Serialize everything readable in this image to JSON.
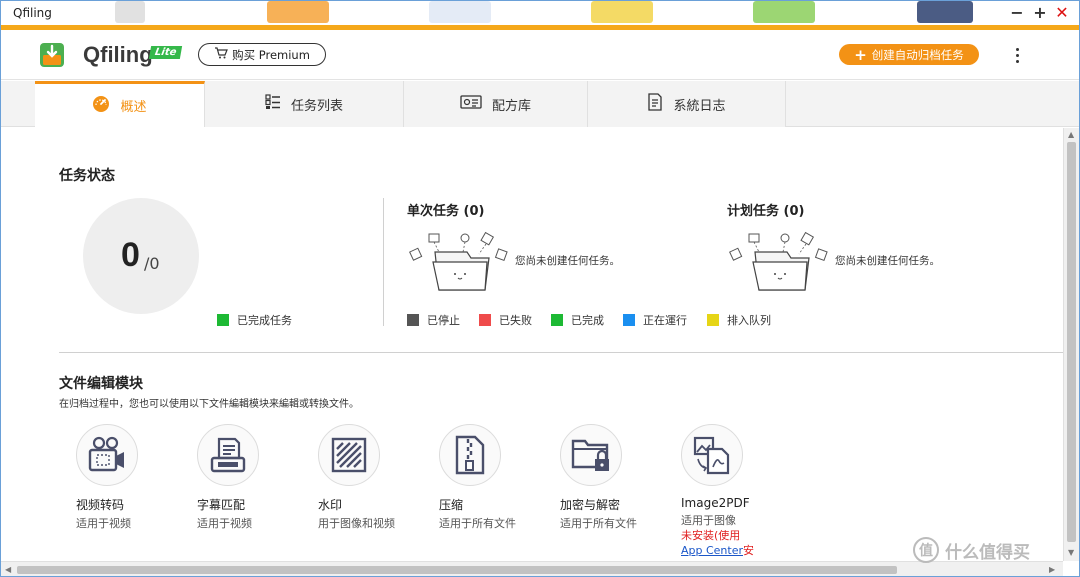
{
  "window": {
    "title": "Qfiling",
    "controls": {
      "minimize": "−",
      "maximize": "+",
      "close": "✕"
    }
  },
  "header": {
    "brand": "Qfiling",
    "badge": "Lite",
    "premium_label": "购买 Premium",
    "create_label": "创建自动归档任务",
    "create_icon": "plus-icon",
    "more_icon": "more-vertical-icon"
  },
  "tabs": [
    {
      "label": "概述",
      "icon": "dashboard-icon",
      "active": true
    },
    {
      "label": "任务列表",
      "icon": "task-list-icon",
      "active": false
    },
    {
      "label": "配方库",
      "icon": "recipe-icon",
      "active": false
    },
    {
      "label": "系統日志",
      "icon": "log-icon",
      "active": false
    }
  ],
  "task_status": {
    "title": "任务状态",
    "completed": "0",
    "total": "/0",
    "legend_completed": "已完成任务",
    "one_time": {
      "title": "单次任务 (0)",
      "empty": "您尚未创建任何任务。"
    },
    "scheduled": {
      "title": "计划任务 (0)",
      "empty": "您尚未创建任何任务。"
    },
    "status_legend": [
      {
        "label": "已停止",
        "color": "#555555"
      },
      {
        "label": "已失败",
        "color": "#ef4b4b"
      },
      {
        "label": "已完成",
        "color": "#1db934"
      },
      {
        "label": "正在運行",
        "color": "#1a8ff0"
      },
      {
        "label": "排入队列",
        "color": "#e6d516"
      }
    ]
  },
  "modules": {
    "title": "文件编辑模块",
    "description": "在归档过程中，您也可以使用以下文件編輯模块来編輯或转換文件。",
    "items": [
      {
        "name": "视频转码",
        "sub": "适用于视频",
        "icon": "video-transcode-icon"
      },
      {
        "name": "字幕匹配",
        "sub": "适用于视频",
        "icon": "subtitle-icon"
      },
      {
        "name": "水印",
        "sub": "用于图像和视频",
        "icon": "watermark-icon"
      },
      {
        "name": "压缩",
        "sub": "适用于所有文件",
        "icon": "compress-icon"
      },
      {
        "name": "加密与解密",
        "sub": "适用于所有文件",
        "icon": "encrypt-icon"
      },
      {
        "name": "Image2PDF",
        "sub": "适用于图像",
        "icon": "image2pdf-icon",
        "warn": "未安装(使用",
        "link": "App Center",
        "link_tail": "安"
      }
    ]
  },
  "watermark": {
    "badge": "值",
    "text": "什么值得买"
  },
  "colors": {
    "accent": "#f39215",
    "success": "#1db934"
  }
}
